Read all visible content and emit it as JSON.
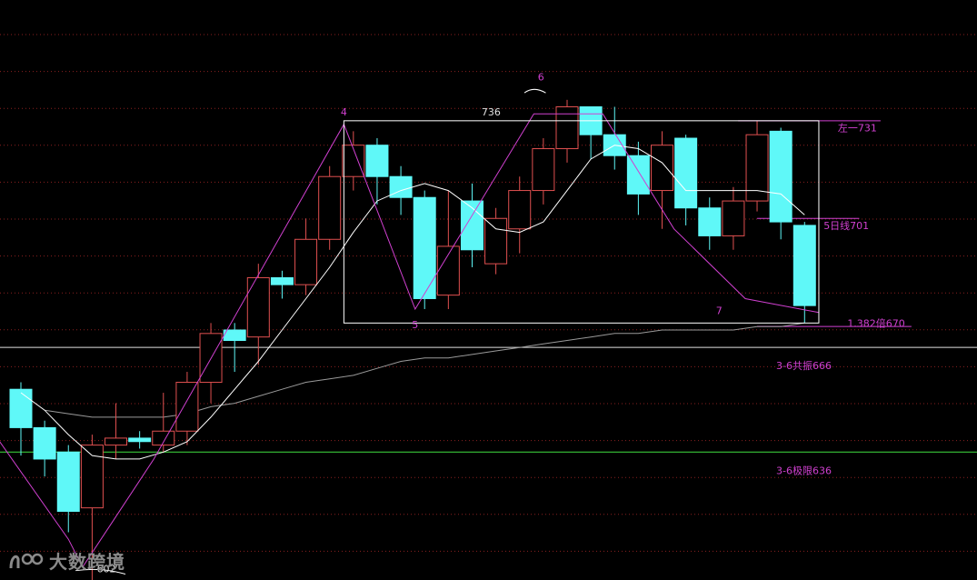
{
  "colors": {
    "background": "#000000",
    "up_candle": "#e05050",
    "down_candle": "#5ff8f8",
    "grid": "#8a2020",
    "ma_short": "#ffffff",
    "ma_long": "#9a9a9a",
    "wave": "#d040d0",
    "box": "#ffffff",
    "level_white": "#e0e0e0",
    "level_green": "#40e040",
    "annotation": "#d040d0",
    "value_text": "#e0e0e0"
  },
  "watermark": {
    "text": "大数跨境",
    "icon": "logo-mark"
  },
  "chart_data": {
    "type": "candlestick",
    "y_range": [
      592,
      746
    ],
    "grid": "dotted horizontal",
    "candles": [
      {
        "o": 654,
        "h": 656,
        "c": 643,
        "l": 635
      },
      {
        "o": 643,
        "h": 645,
        "c": 634,
        "l": 629
      },
      {
        "o": 636,
        "h": 638,
        "c": 619,
        "l": 613
      },
      {
        "o": 620,
        "h": 641,
        "c": 638,
        "l": 599
      },
      {
        "o": 638,
        "h": 650,
        "c": 640,
        "l": 634
      },
      {
        "o": 640,
        "h": 642,
        "c": 639,
        "l": 637
      },
      {
        "o": 638,
        "h": 653,
        "c": 642,
        "l": 636
      },
      {
        "o": 642,
        "h": 659,
        "c": 656,
        "l": 638
      },
      {
        "o": 656,
        "h": 673,
        "c": 670,
        "l": 650
      },
      {
        "o": 671,
        "h": 673,
        "c": 668,
        "l": 659
      },
      {
        "o": 669,
        "h": 690,
        "c": 686,
        "l": 661
      },
      {
        "o": 686,
        "h": 688,
        "c": 684,
        "l": 680
      },
      {
        "o": 684,
        "h": 703,
        "c": 697,
        "l": 681
      },
      {
        "o": 697,
        "h": 718,
        "c": 715,
        "l": 694
      },
      {
        "o": 715,
        "h": 728,
        "c": 724,
        "l": 711
      },
      {
        "o": 724,
        "h": 726,
        "c": 715,
        "l": 707
      },
      {
        "o": 715,
        "h": 718,
        "c": 709,
        "l": 704
      },
      {
        "o": 709,
        "h": 711,
        "c": 680,
        "l": 677
      },
      {
        "o": 681,
        "h": 711,
        "c": 695,
        "l": 677
      },
      {
        "o": 708,
        "h": 713,
        "c": 694,
        "l": 689
      },
      {
        "o": 690,
        "h": 706,
        "c": 703,
        "l": 687
      },
      {
        "o": 700,
        "h": 715,
        "c": 711,
        "l": 693
      },
      {
        "o": 711,
        "h": 726,
        "c": 723,
        "l": 707
      },
      {
        "o": 723,
        "h": 737,
        "c": 735,
        "l": 719
      },
      {
        "o": 735,
        "h": 734,
        "c": 727,
        "l": 720
      },
      {
        "o": 727,
        "h": 735,
        "c": 721,
        "l": 717
      },
      {
        "o": 721,
        "h": 725,
        "c": 710,
        "l": 704
      },
      {
        "o": 711,
        "h": 728,
        "c": 724,
        "l": 700
      },
      {
        "o": 726,
        "h": 727,
        "c": 706,
        "l": 701
      },
      {
        "o": 706,
        "h": 709,
        "c": 698,
        "l": 694
      },
      {
        "o": 698,
        "h": 712,
        "c": 708,
        "l": 694
      },
      {
        "o": 708,
        "h": 731,
        "c": 727,
        "l": 705
      },
      {
        "o": 728,
        "h": 729,
        "c": 702,
        "l": 697
      },
      {
        "o": 701,
        "h": 702,
        "c": 678,
        "l": 673
      }
    ],
    "ma_short": [
      653,
      648,
      641,
      635,
      634,
      634,
      636,
      639,
      646,
      654,
      662,
      671,
      680,
      689,
      699,
      708,
      711,
      713,
      711,
      706,
      700,
      699,
      702,
      711,
      720,
      724,
      723,
      719,
      711,
      711,
      711,
      711,
      710,
      704
    ],
    "ma_long": [
      null,
      648,
      647,
      646,
      646,
      646,
      646,
      647,
      649,
      650,
      652,
      654,
      656,
      657,
      658,
      660,
      662,
      663,
      663,
      664,
      665,
      666,
      667,
      668,
      669,
      670,
      670,
      671,
      671,
      671,
      671,
      672,
      672,
      673
    ],
    "wave_points": [
      {
        "i": -1,
        "v": 640
      },
      {
        "i": 2,
        "v": 611
      },
      {
        "i": 2.6,
        "v": 603
      },
      {
        "i": 5.6,
        "v": 634
      },
      {
        "i": 13.6,
        "v": 730
      },
      {
        "i": 16.6,
        "v": 677
      },
      {
        "i": 21.6,
        "v": 733
      },
      {
        "i": 24.5,
        "v": 733
      },
      {
        "i": 27.5,
        "v": 700
      },
      {
        "i": 30.5,
        "v": 680
      },
      {
        "i": 33.6,
        "v": 676
      }
    ],
    "box": {
      "i0": 13.6,
      "i1": 33.6,
      "top": 731,
      "bottom": 673
    },
    "horizontal_levels": [
      {
        "value": 666,
        "label": "3-6共振666",
        "color_key": "level_white"
      },
      {
        "value": 636,
        "label": "3-6极限636",
        "color_key": "level_green"
      }
    ],
    "annotations": [
      {
        "text": "左一731",
        "i": 34.4,
        "v": 729
      },
      {
        "text": "5日线701",
        "i": 33.8,
        "v": 701
      },
      {
        "text": "1.382倍670",
        "i": 34.8,
        "v": 673
      }
    ],
    "short_levels": [
      {
        "v": 731,
        "i0": 30.2,
        "i1": 36.2
      },
      {
        "v": 703,
        "i0": 31.0,
        "i1": 35.3
      },
      {
        "v": 672,
        "i0": 31.0,
        "i1": 37.5
      }
    ],
    "point_labels": [
      {
        "text": "4",
        "i": 13.6,
        "v": 732.5,
        "color_key": "annotation"
      },
      {
        "text": "5",
        "i": 16.6,
        "v": 671.5,
        "color_key": "annotation"
      },
      {
        "text": "6",
        "i": 21.9,
        "v": 742.5,
        "color_key": "annotation"
      },
      {
        "text": "736",
        "i": 19.8,
        "v": 732.5,
        "color_key": "value_text"
      },
      {
        "text": "7",
        "i": 29.4,
        "v": 675.5,
        "color_key": "annotation"
      },
      {
        "text": "602",
        "i": 3.6,
        "v": 601.5,
        "color_key": "value_text"
      }
    ]
  }
}
